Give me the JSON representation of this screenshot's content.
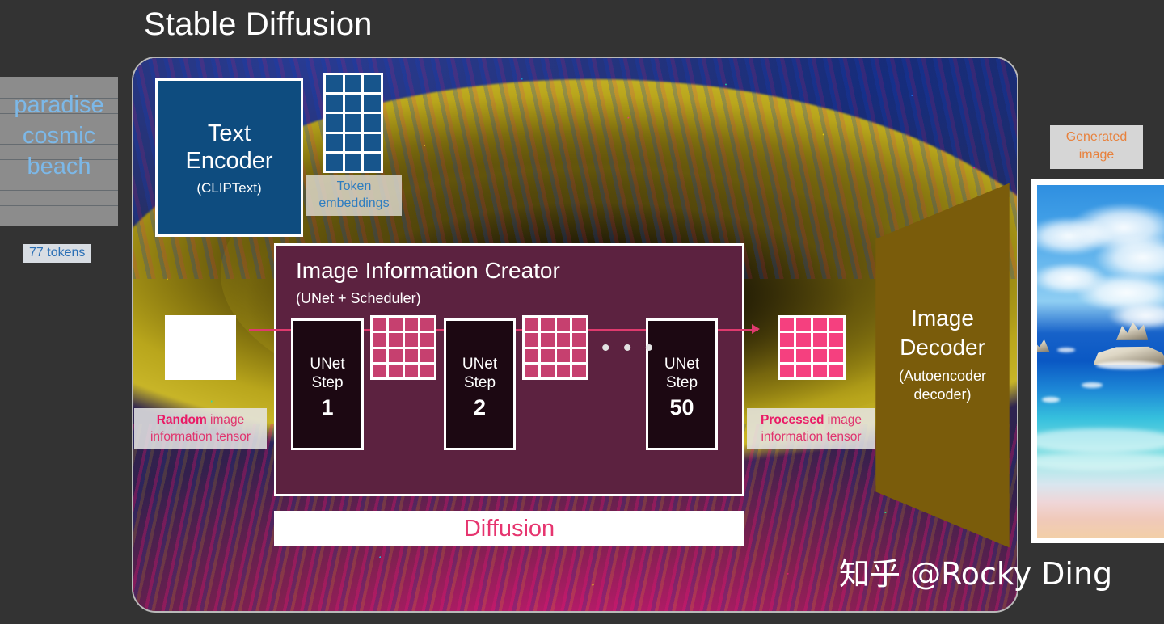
{
  "title": "Stable Diffusion",
  "prompt": {
    "text": "paradise\ncosmic\nbeach",
    "tokens_badge": "77 tokens"
  },
  "text_encoder": {
    "name": "Text\nEncoder",
    "subtitle": "(CLIPText)"
  },
  "token_embeddings": {
    "label": "Token\nembeddings",
    "cols": 3,
    "rows": 5
  },
  "image_information_creator": {
    "title": "Image Information Creator",
    "subtitle": "(UNet + Scheduler)",
    "steps": [
      {
        "name": "UNet\nStep",
        "number": "1"
      },
      {
        "name": "UNet\nStep",
        "number": "2"
      },
      {
        "name": "UNet\nStep",
        "number": "50"
      }
    ],
    "ellipsis": "• • •",
    "diffusion_label": "Diffusion"
  },
  "tensors": {
    "random": {
      "emphasis": "Random",
      "rest": " image\ninformation tensor"
    },
    "processed": {
      "emphasis": "Processed",
      "rest": " image\ninformation tensor"
    }
  },
  "image_decoder": {
    "name": "Image\nDecoder",
    "subtitle": "(Autoencoder\ndecoder)"
  },
  "generated": {
    "label": "Generated\nimage"
  },
  "watermark": "知乎 @Rocky Ding",
  "colors": {
    "background": "#333333",
    "text_encoder": "#0e4c7f",
    "token_cell": "#17558c",
    "iic_panel": "#5c2240",
    "unet_box": "#1c0812",
    "latent_mid": "#c6406f",
    "latent_bright": "#f5407f",
    "decoder": "#7a5c0b",
    "accent_pink": "#e6356f",
    "accent_orange": "#e8813c",
    "prompt_text": "#7cb8e8",
    "token_label_text": "#2e7dc0"
  }
}
